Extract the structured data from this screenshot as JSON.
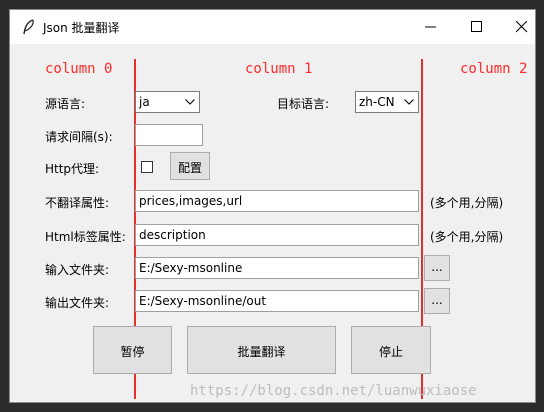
{
  "window": {
    "title": "Json 批量翻译",
    "icons": {
      "app": "feather-icon",
      "minimize": "minimize-icon",
      "maximize": "maximize-icon",
      "close": "close-icon"
    }
  },
  "grid": {
    "col0": "column 0",
    "col1": "column 1",
    "col2": "column 2",
    "accent": "#ff2a2a"
  },
  "form": {
    "source_lang": {
      "label": "源语言:",
      "value": "ja"
    },
    "target_lang": {
      "label": "目标语言:",
      "value": "zh-CN"
    },
    "interval": {
      "label": "请求间隔(s):",
      "value": ""
    },
    "proxy": {
      "label": "Http代理:",
      "checked": false,
      "config_button": "配置"
    },
    "exclude_attrs": {
      "label": "不翻译属性:",
      "value": "prices,images,url",
      "hint": "(多个用,分隔)"
    },
    "html_attrs": {
      "label": "Html标签属性:",
      "value": "description",
      "hint": "(多个用,分隔)"
    },
    "input_dir": {
      "label": "输入文件夹:",
      "value": "E:/Sexy-msonline",
      "browse": "..."
    },
    "output_dir": {
      "label": "输出文件夹:",
      "value": "E:/Sexy-msonline/out",
      "browse": "..."
    }
  },
  "actions": {
    "pause": "暂停",
    "batch_translate": "批量翻译",
    "stop": "停止"
  },
  "watermark": "https://blog.csdn.net/luanwuxiaose"
}
